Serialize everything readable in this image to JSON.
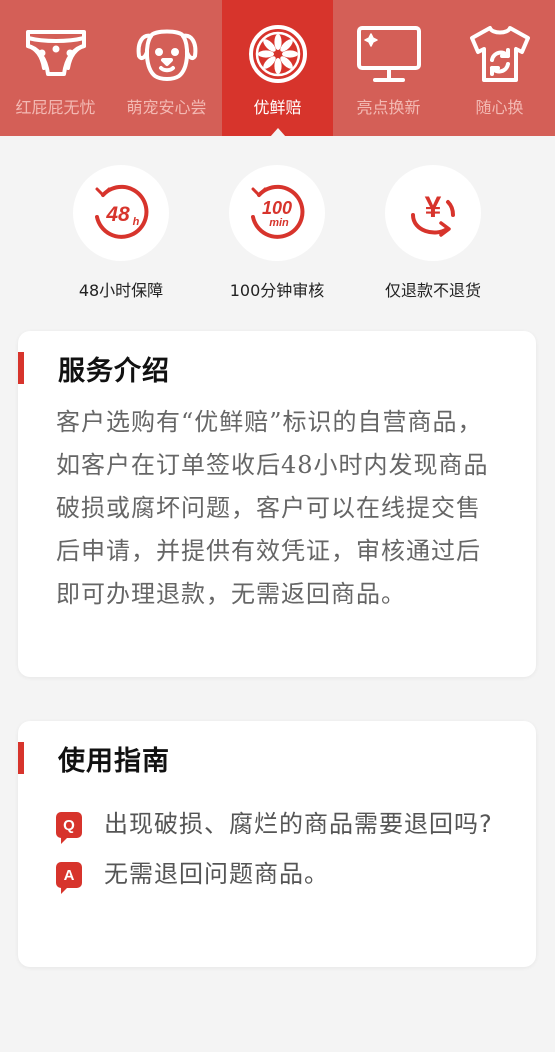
{
  "tabs": [
    {
      "label": "红屁屁无忧",
      "icon": "diaper-icon",
      "active": false
    },
    {
      "label": "萌宠安心尝",
      "icon": "dog-face-icon",
      "active": false
    },
    {
      "label": "优鲜赔",
      "icon": "citrus-slice-icon",
      "active": true
    },
    {
      "label": "亮点换新",
      "icon": "monitor-icon",
      "active": false
    },
    {
      "label": "随心换",
      "icon": "tshirt-icon",
      "active": false
    }
  ],
  "features": [
    {
      "label": "48小时保障",
      "icon": "48h-icon",
      "icon_text": "48",
      "icon_sub": "h"
    },
    {
      "label": "100分钟审核",
      "icon": "100min-icon",
      "icon_text": "100",
      "icon_sub": "min"
    },
    {
      "label": "仅退款不退货",
      "icon": "yuan-refund-icon",
      "icon_text": "¥"
    }
  ],
  "service_card": {
    "title": "服务介绍",
    "body": "客户选购有“优鲜赔”标识的自营商品，如客户在订单签收后48小时内发现商品破损或腐坏问题，客户可以在线提交售后申请，并提供有效凭证，审核通过后即可办理退款，无需返回商品。"
  },
  "guide_card": {
    "title": "使用指南",
    "q_badge": "Q",
    "question": "出现破损、腐烂的商品需要退回吗?",
    "a_badge": "A",
    "answer": "无需退回问题商品。"
  },
  "colors": {
    "tabbar_bg": "#d45f57",
    "tab_active_bg": "#d7342c",
    "accent": "#d7342c",
    "page_bg": "#f4f4f4"
  }
}
